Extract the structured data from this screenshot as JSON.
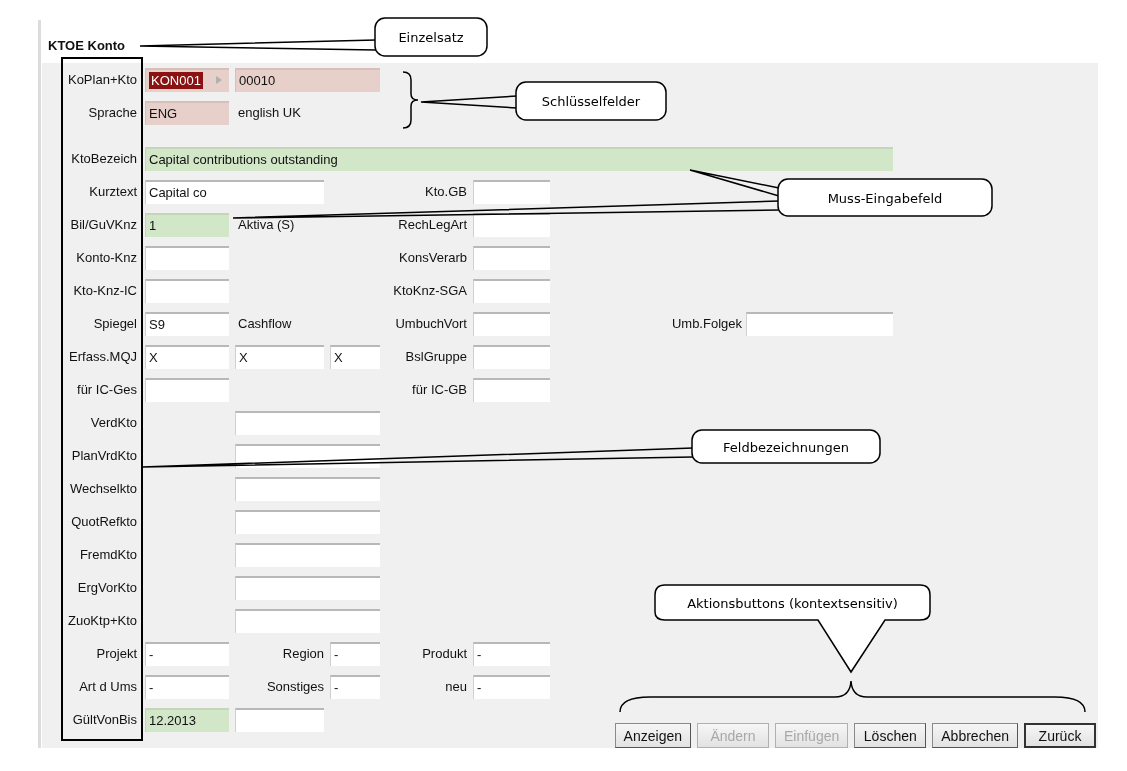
{
  "title": "KTOE Konto",
  "sections": [
    {
      "rows": [
        {
          "label": "KoPlan+Kto",
          "cells": [
            {
              "kind": "code",
              "key": true,
              "required": false,
              "value": "KON001",
              "selected": true,
              "dropdown": true
            },
            {
              "kind": "long",
              "key": true,
              "required": false,
              "value": "00010"
            }
          ]
        },
        {
          "label": "Sprache",
          "cells": [
            {
              "kind": "code",
              "key": true,
              "required": false,
              "value": "ENG"
            },
            {
              "kind": "desc_text",
              "value": "english UK"
            }
          ]
        }
      ]
    },
    {
      "rows": [
        {
          "label": "KtoBezeich",
          "cells": [
            {
              "kind": "full",
              "key": false,
              "required": true,
              "value": "Capital contributions outstanding"
            }
          ]
        },
        {
          "label": "Kurztext",
          "cells": [
            {
              "kind": "wide",
              "key": false,
              "required": false,
              "value": "Capital co"
            }
          ],
          "pairs": [
            {
              "kind": "right",
              "label": "Kto.GB",
              "key": false,
              "required": false
            }
          ]
        },
        {
          "label": "Bil/GuVKnz",
          "cells": [
            {
              "kind": "code",
              "key": false,
              "required": true,
              "value": "1"
            },
            {
              "kind": "desc_text",
              "value": "Aktiva (S)"
            }
          ],
          "pairs": [
            {
              "kind": "right",
              "label": "RechLegArt",
              "key": false,
              "required": false
            }
          ]
        },
        {
          "label": "Konto-Knz",
          "cells": [
            {
              "kind": "code",
              "key": false,
              "required": false
            }
          ],
          "pairs": [
            {
              "kind": "right",
              "label": "KonsVerarb",
              "key": false,
              "required": false
            }
          ]
        },
        {
          "label": "Kto-Knz-IC",
          "cells": [
            {
              "kind": "code",
              "key": false,
              "required": false
            }
          ],
          "pairs": [
            {
              "kind": "right",
              "label": "KtoKnz-SGA",
              "key": false,
              "required": false
            }
          ]
        },
        {
          "label": "Spiegel",
          "cells": [
            {
              "kind": "code",
              "key": false,
              "required": false,
              "value": "S9"
            },
            {
              "kind": "desc_text",
              "value": "Cashflow"
            }
          ],
          "pairs": [
            {
              "kind": "right",
              "label": "UmbuchVort",
              "key": false,
              "required": false
            },
            {
              "kind": "far",
              "label": "Umb.Folgek",
              "key": false,
              "required": false
            }
          ]
        },
        {
          "label": "Erfass.MQJ",
          "cells": [
            {
              "kind": "code",
              "key": false,
              "required": false,
              "value": "X"
            },
            {
              "kind": "desc",
              "key": false,
              "required": false,
              "value": "X"
            },
            {
              "kind": "tiny",
              "key": false,
              "required": false,
              "value": "X"
            }
          ],
          "pairs": [
            {
              "kind": "right",
              "label": "BslGruppe",
              "key": false,
              "required": false
            }
          ]
        },
        {
          "label": "für IC-Ges",
          "cells": [
            {
              "kind": "code",
              "key": false,
              "required": false
            }
          ],
          "pairs": [
            {
              "kind": "right",
              "label": "für IC-GB",
              "key": false,
              "required": false
            }
          ]
        },
        {
          "label": "VerdKto",
          "cells": [
            {
              "kind": "long",
              "key": false,
              "required": false
            }
          ]
        },
        {
          "label": "PlanVrdKto",
          "cells": [
            {
              "kind": "long",
              "key": false,
              "required": false
            }
          ]
        },
        {
          "label": "Wechselkto",
          "cells": [
            {
              "kind": "long",
              "key": false,
              "required": false
            }
          ]
        },
        {
          "label": "QuotRefkto",
          "cells": [
            {
              "kind": "long",
              "key": false,
              "required": false
            }
          ]
        },
        {
          "label": "FremdKto",
          "cells": [
            {
              "kind": "long",
              "key": false,
              "required": false
            }
          ]
        },
        {
          "label": "ErgVorKto",
          "cells": [
            {
              "kind": "long",
              "key": false,
              "required": false
            }
          ]
        },
        {
          "label": "ZuoKtp+Kto",
          "cells": [
            {
              "kind": "long",
              "key": false,
              "required": false
            }
          ]
        },
        {
          "label": "Projekt",
          "cells": [
            {
              "kind": "code",
              "key": false,
              "required": false,
              "value": "-"
            }
          ],
          "pairs": [
            {
              "kind": "mid",
              "label": "Region",
              "key": false,
              "required": false,
              "value": "-"
            },
            {
              "kind": "right",
              "label": "Produkt",
              "key": false,
              "required": false,
              "value": "-"
            }
          ]
        },
        {
          "label": "Art d Ums",
          "cells": [
            {
              "kind": "code",
              "key": false,
              "required": false,
              "value": "-"
            }
          ],
          "pairs": [
            {
              "kind": "mid",
              "label": "Sonstiges",
              "key": false,
              "required": false,
              "value": "-"
            },
            {
              "kind": "right",
              "label": "neu",
              "key": false,
              "required": false,
              "value": "-"
            }
          ]
        },
        {
          "label": "GültVonBis",
          "cells": [
            {
              "kind": "code",
              "key": false,
              "required": true,
              "value": "12.2013"
            },
            {
              "kind": "desc",
              "key": false,
              "required": false
            }
          ]
        }
      ]
    }
  ],
  "buttons": [
    {
      "label": "Anzeigen",
      "disabled": false,
      "default": false
    },
    {
      "label": "Ändern",
      "disabled": true,
      "default": false
    },
    {
      "label": "Einfügen",
      "disabled": true,
      "default": false
    },
    {
      "label": "Löschen",
      "disabled": false,
      "default": false
    },
    {
      "label": "Abbrechen",
      "disabled": false,
      "default": false
    },
    {
      "label": "Zurück",
      "disabled": false,
      "default": true
    }
  ],
  "annotations": [
    {
      "text": "Einzelsatz"
    },
    {
      "text": "Schlüsselfelder"
    },
    {
      "text": "Muss-Eingabefeld"
    },
    {
      "text": "Feldbezeichnungen"
    },
    {
      "text": "Aktionsbuttons  (kontextsensitiv)"
    }
  ]
}
